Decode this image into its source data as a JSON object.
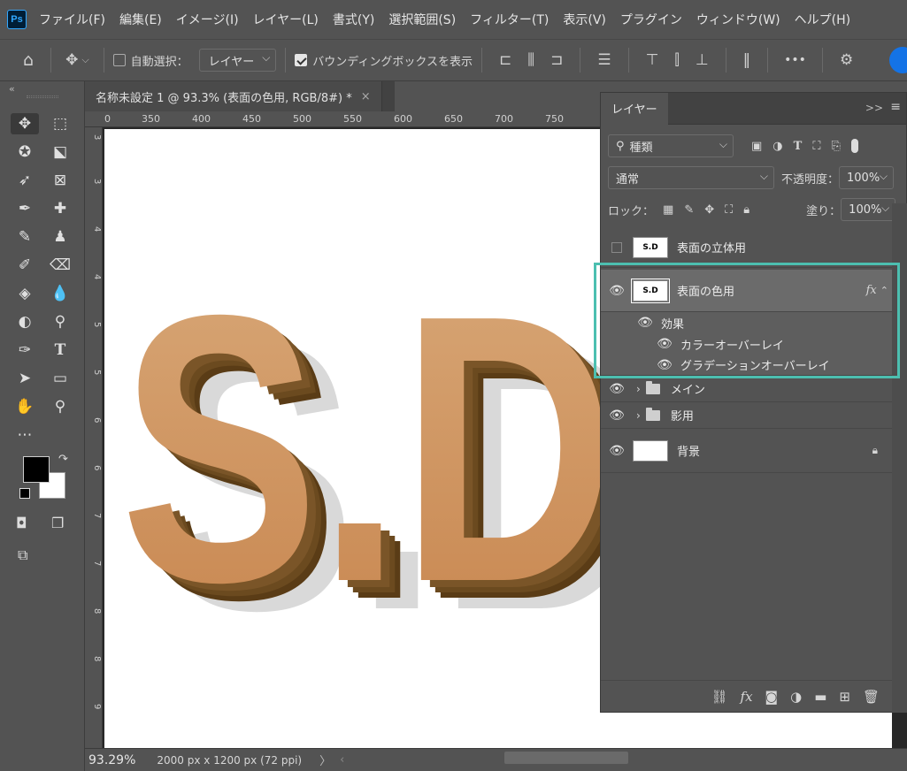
{
  "app": {
    "logo": "Ps"
  },
  "menu": [
    "ファイル(F)",
    "編集(E)",
    "イメージ(I)",
    "レイヤー(L)",
    "書式(Y)",
    "選択範囲(S)",
    "フィルター(T)",
    "表示(V)",
    "プラグイン",
    "ウィンドウ(W)",
    "ヘルプ(H)"
  ],
  "options": {
    "auto_select_label": "自動選択：",
    "auto_select_value": "レイヤー",
    "bbox_label": "バウンディングボックスを表示",
    "more": "•••"
  },
  "document": {
    "tab_title": "名称未設定 1 @ 93.3% (表面の色用, RGB/8#) *",
    "tab_close": "×",
    "ruler_h": [
      "0",
      "350",
      "400",
      "450",
      "500",
      "550",
      "600",
      "650",
      "700",
      "750"
    ],
    "ruler_v": [
      "3",
      "3",
      "4",
      "4",
      "5",
      "5",
      "6",
      "6",
      "7",
      "7",
      "8",
      "8",
      "9"
    ],
    "canvas_text": "S.D",
    "colors": {
      "letter_top": "#d8a878",
      "letter_bottom": "#c8864f",
      "extrude": "#6b4a1f",
      "shadow": "#d9d9d9"
    }
  },
  "status": {
    "zoom": "93.29%",
    "doc_size": "2000 px x 1200 px (72 ppi)",
    "arrow": "〉"
  },
  "layers_panel": {
    "tab": "レイヤー",
    "collapse": ">>",
    "menu": "≡",
    "filter_label": "種類",
    "blend_mode": "通常",
    "opacity_label": "不透明度：",
    "opacity_value": "100%",
    "lock_label": "ロック：",
    "fill_label": "塗り：",
    "fill_value": "100%",
    "layers": [
      {
        "name": "表面の立体用",
        "visible": false,
        "thumb": "S.D"
      },
      {
        "name": "表面の色用",
        "visible": true,
        "thumb": "S.D",
        "fx": "fx",
        "selected": true
      },
      {
        "name": "効果",
        "visible": true
      },
      {
        "name": "カラーオーバーレイ",
        "visible": true
      },
      {
        "name": "グラデーションオーバーレイ",
        "visible": true
      },
      {
        "name": "メイン",
        "visible": true,
        "folder": true
      },
      {
        "name": "影用",
        "visible": true,
        "folder": true
      },
      {
        "name": "背景",
        "visible": true
      }
    ]
  },
  "highlight_color": "#4cbfb0"
}
